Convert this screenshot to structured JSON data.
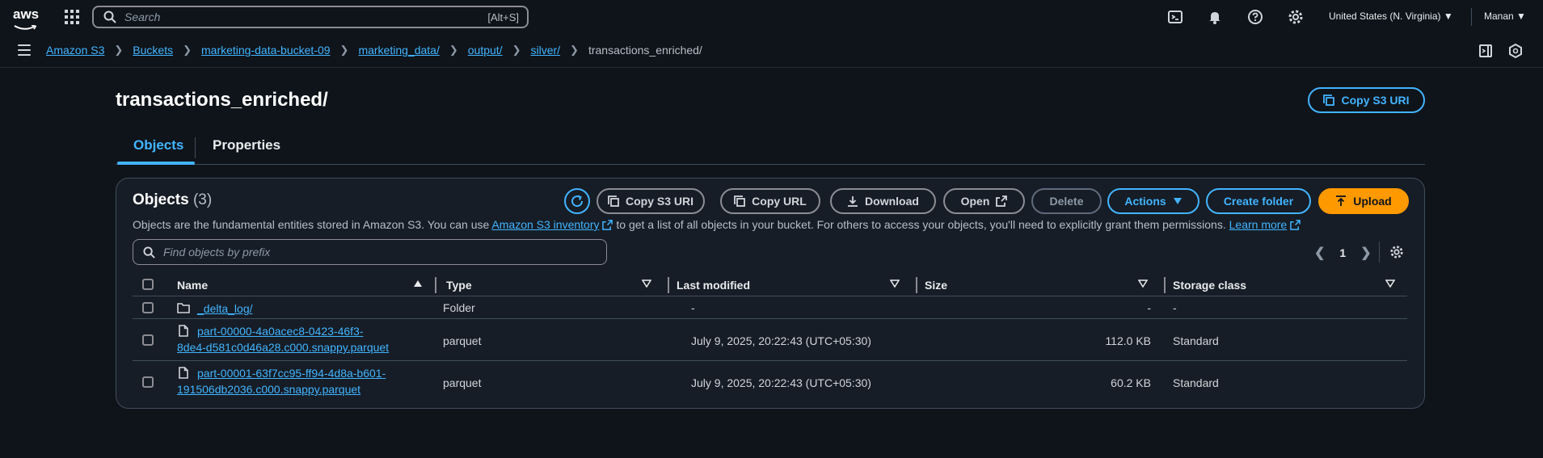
{
  "topnav": {
    "logo": "aws",
    "search_placeholder": "Search",
    "search_shortcut": "[Alt+S]",
    "region": "United States (N. Virginia) ▼",
    "user": "Manan ▼"
  },
  "breadcrumb": {
    "items": [
      "Amazon S3",
      "Buckets",
      "marketing-data-bucket-09",
      "marketing_data/",
      "output/",
      "silver/"
    ],
    "current": "transactions_enriched/"
  },
  "page": {
    "title": "transactions_enriched/",
    "copy_s3_uri": "Copy S3 URI"
  },
  "tabs": [
    {
      "label": "Objects"
    },
    {
      "label": "Properties"
    }
  ],
  "objects_panel": {
    "title": "Objects",
    "count": "(3)",
    "toolbar": {
      "copy_s3_uri": "Copy S3 URI",
      "copy_url": "Copy URL",
      "download": "Download",
      "open": "Open",
      "delete": "Delete",
      "actions": "Actions",
      "create_folder": "Create folder",
      "upload": "Upload"
    },
    "description_pre": "Objects are the fundamental entities stored in Amazon S3. You can use",
    "inventory_link": "Amazon S3 inventory",
    "description_post": "to get a list of all objects in your bucket. For others to access your objects, you'll need to explicitly grant them permissions.",
    "learn_more": "Learn more",
    "filter_placeholder": "Find objects by prefix",
    "page_number": "1",
    "columns": [
      "Name",
      "Type",
      "Last modified",
      "Size",
      "Storage class"
    ],
    "rows": [
      {
        "name_line1": "_delta_log/",
        "name_line2": "",
        "type": "Folder",
        "modified": "-",
        "size": "-",
        "storage": "-"
      },
      {
        "name_line1": "part-00000-4a0acec8-0423-46f3-",
        "name_line2": "8de4-d581c0d46a28.c000.snappy.parquet",
        "type": "parquet",
        "modified": "July 9, 2025, 20:22:43 (UTC+05:30)",
        "size": "112.0 KB",
        "storage": "Standard"
      },
      {
        "name_line1": "part-00001-63f7cc95-ff94-4d8a-b601-",
        "name_line2": "191506db2036.c000.snappy.parquet",
        "type": "parquet",
        "modified": "July 9, 2025, 20:22:43 (UTC+05:30)",
        "size": "60.2 KB",
        "storage": "Standard"
      }
    ]
  }
}
